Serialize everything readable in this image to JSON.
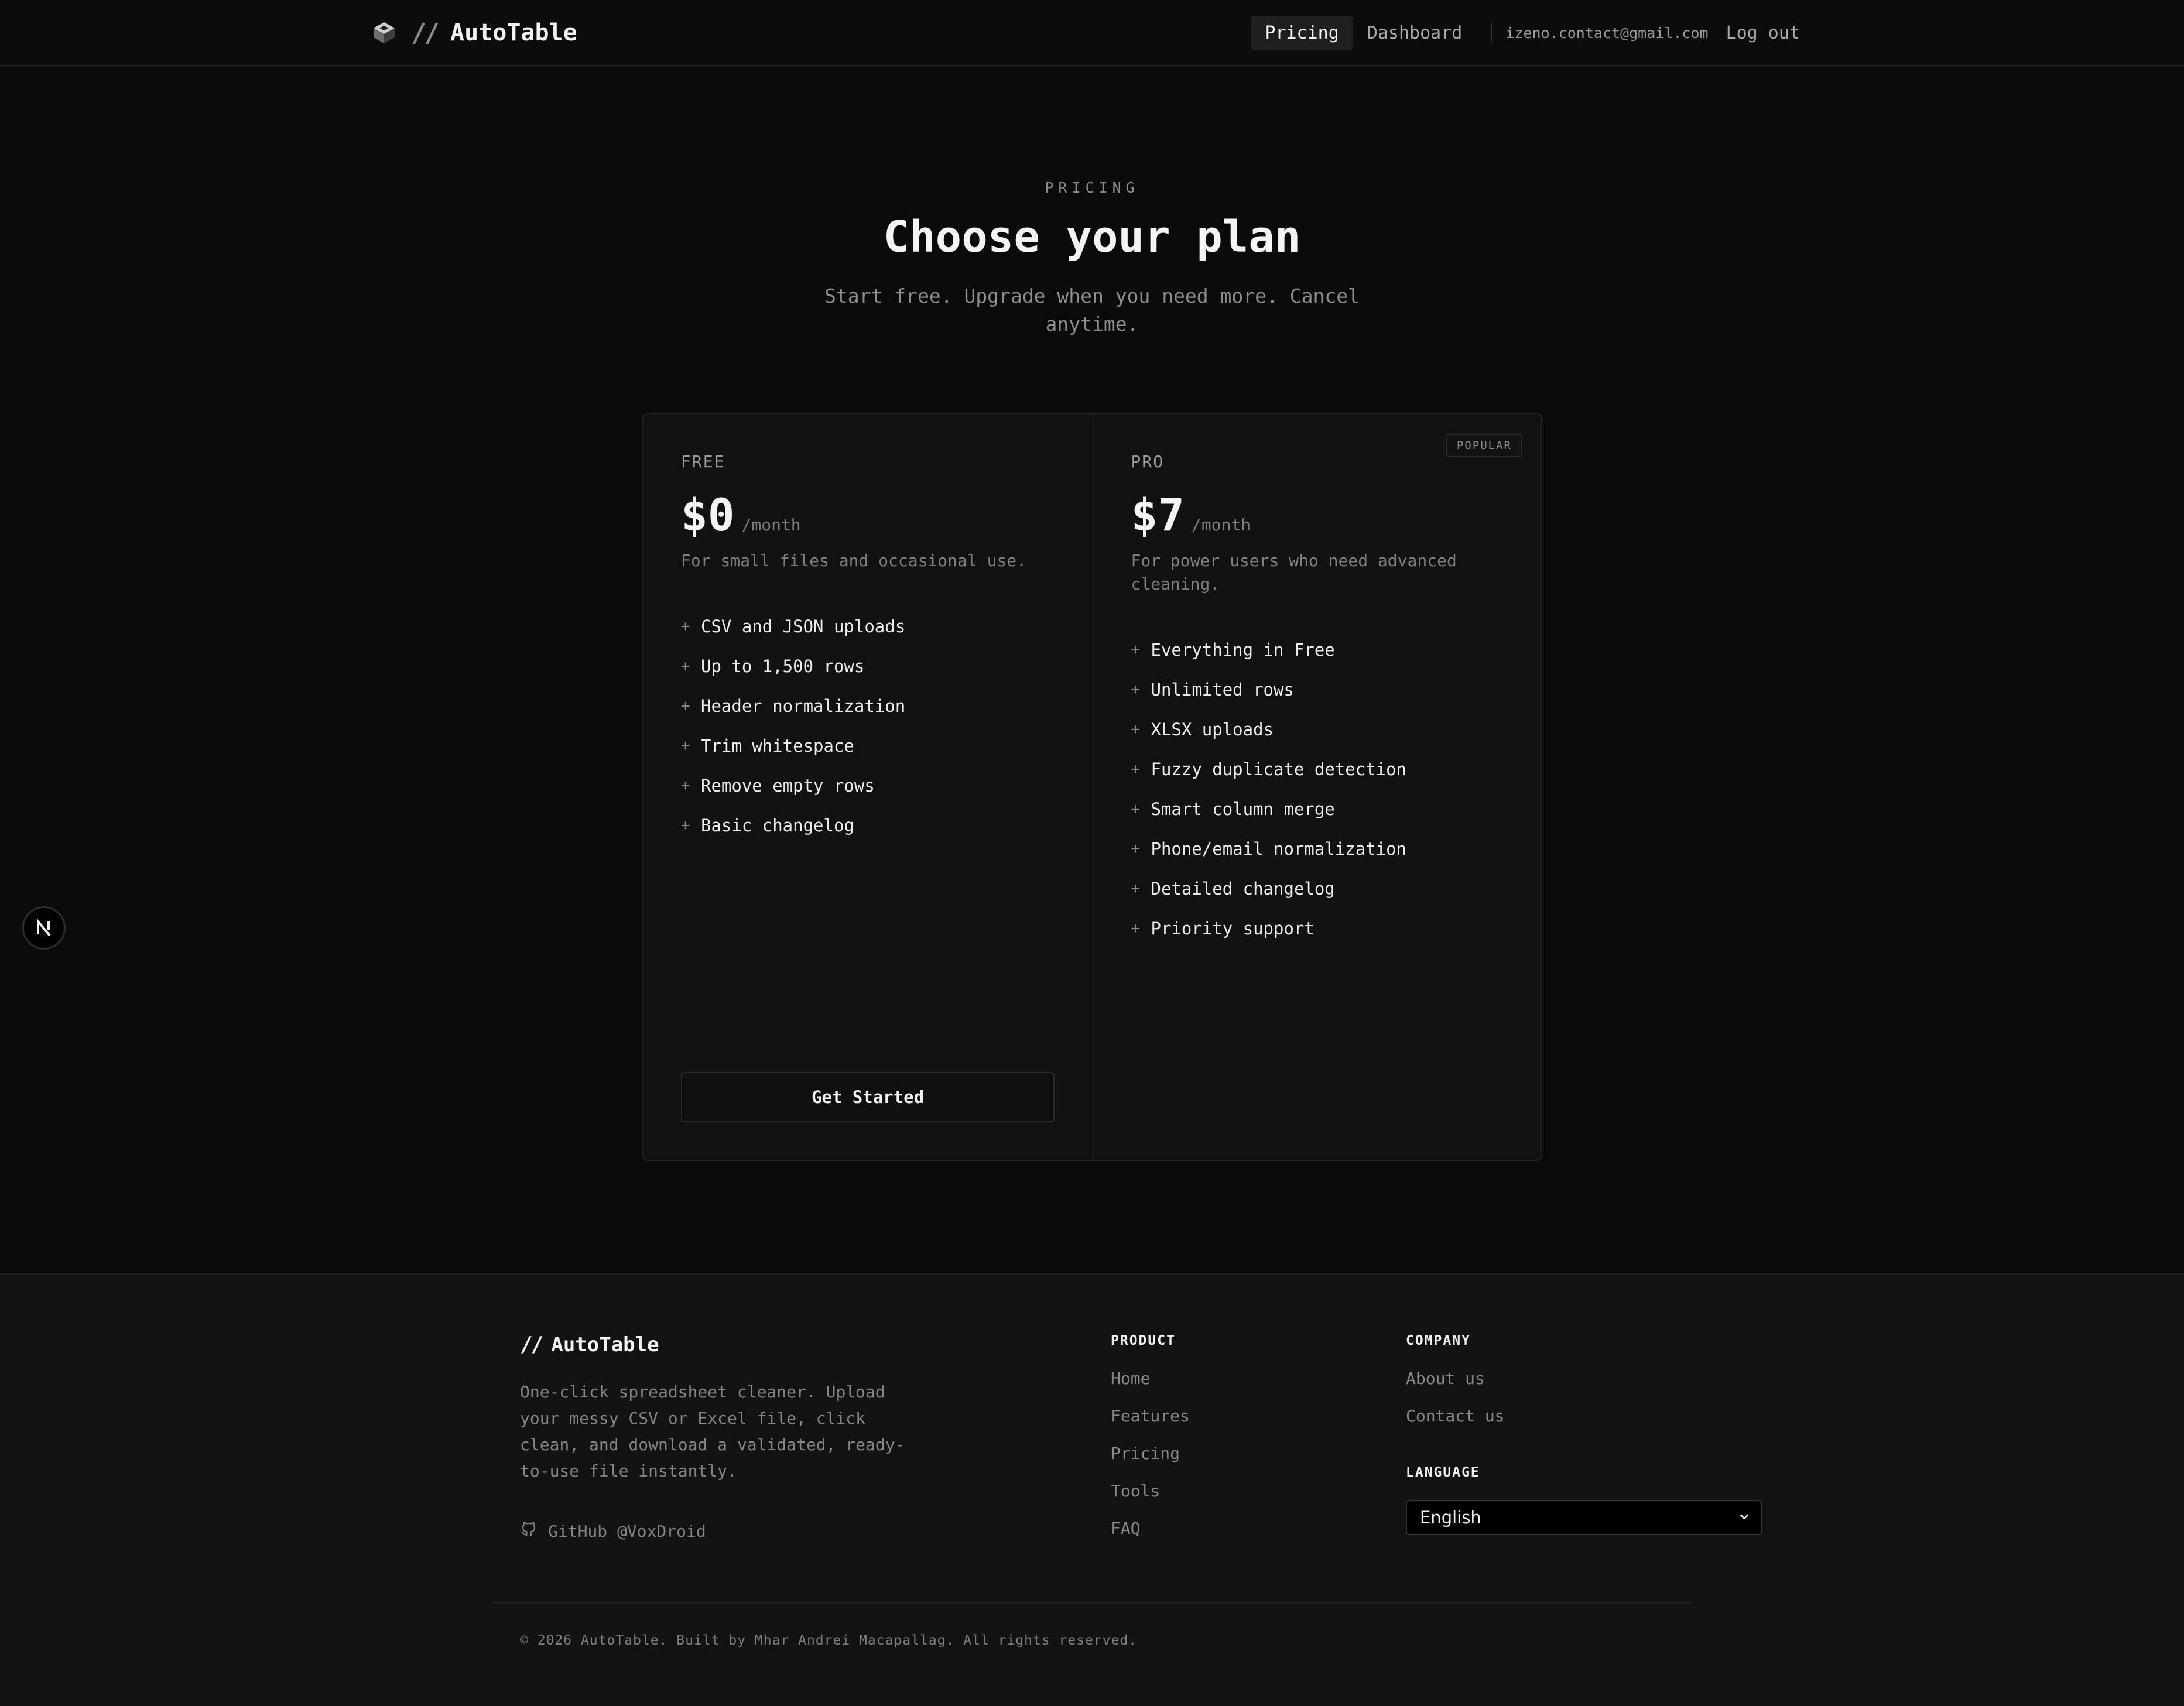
{
  "nav": {
    "brand_slash": "//",
    "brand_name": "AutoTable",
    "links": [
      {
        "label": "Pricing",
        "active": true
      },
      {
        "label": "Dashboard",
        "active": false
      }
    ],
    "email": "izeno.contact@gmail.com",
    "logout": "Log out"
  },
  "hero": {
    "eyebrow": "PRICING",
    "title": "Choose your plan",
    "subtitle": "Start free. Upgrade when you need more. Cancel anytime."
  },
  "plans": [
    {
      "name": "FREE",
      "price": "$0",
      "period": "/month",
      "description": "For small files and occasional use.",
      "features": [
        "CSV and JSON uploads",
        "Up to 1,500 rows",
        "Header normalization",
        "Trim whitespace",
        "Remove empty rows",
        "Basic changelog"
      ],
      "cta": "Get Started"
    },
    {
      "name": "PRO",
      "badge": "POPULAR",
      "price": "$7",
      "period": "/month",
      "description": "For power users who need advanced cleaning.",
      "features": [
        "Everything in Free",
        "Unlimited rows",
        "XLSX uploads",
        "Fuzzy duplicate detection",
        "Smart column merge",
        "Phone/email normalization",
        "Detailed changelog",
        "Priority support"
      ]
    }
  ],
  "footer": {
    "brand_slash": "//",
    "brand_name": "AutoTable",
    "description": "One-click spreadsheet cleaner. Upload your messy CSV or Excel file, click clean, and download a validated, ready-to-use file instantly.",
    "github": "GitHub @VoxDroid",
    "product": {
      "heading": "PRODUCT",
      "links": [
        "Home",
        "Features",
        "Pricing",
        "Tools",
        "FAQ"
      ]
    },
    "company": {
      "heading": "COMPANY",
      "links": [
        "About us",
        "Contact us"
      ]
    },
    "language": {
      "heading": "LANGUAGE",
      "selected": "English"
    },
    "copyright": "© 2026 AutoTable. Built by Mhar Andrei Macapallag. All rights reserved."
  },
  "icons": {
    "brand_logo": "cube-icon",
    "github": "github-icon",
    "select_chevron": "chevron-down-icon",
    "floating": "nextjs-icon",
    "feature_bullet": "plus-icon"
  },
  "colors": {
    "background": "#0b0b0b",
    "card": "#121212",
    "footer": "#131313",
    "text": "#ededed",
    "muted": "#8a8a8a"
  }
}
